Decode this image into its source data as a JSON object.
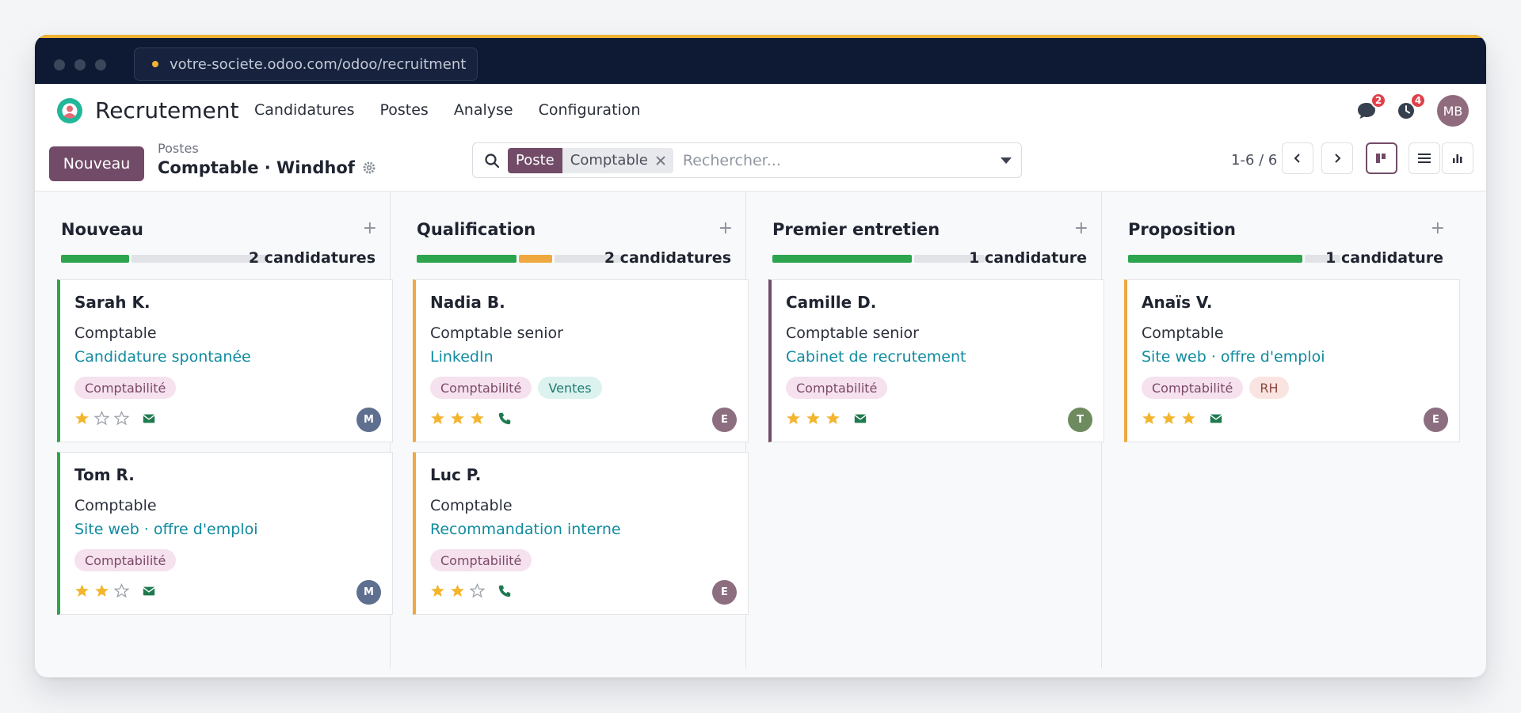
{
  "browser": {
    "url": "votre-societe.odoo.com/odoo/recruitment"
  },
  "app": {
    "name": "Recrutement",
    "menu": [
      "Candidatures",
      "Postes",
      "Analyse",
      "Configuration"
    ],
    "messages_badge": "2",
    "activities_badge": "4",
    "user_initials": "MB"
  },
  "control": {
    "new_label": "Nouveau",
    "breadcrumb": "Postes",
    "title": "Comptable · Windhof",
    "facet_key": "Poste",
    "facet_value": "Comptable",
    "search_placeholder": "Rechercher...",
    "pager": "1-6 / 6"
  },
  "columns": [
    {
      "title": "Nouveau",
      "count": "2 candidatures",
      "cards": [
        {
          "name": "Sarah K.",
          "job": "Comptable",
          "source": "Candidature spontanée",
          "tags": [
            "Comptabilité"
          ],
          "stars": 1,
          "contact": "mail-icon",
          "avatar": "M"
        },
        {
          "name": "Tom R.",
          "job": "Comptable",
          "source": "Site web · offre d'emploi",
          "tags": [
            "Comptabilité"
          ],
          "stars": 2,
          "contact": "mail-icon",
          "avatar": "M"
        }
      ]
    },
    {
      "title": "Qualification",
      "count": "2 candidatures",
      "cards": [
        {
          "name": "Nadia B.",
          "job": "Comptable senior",
          "source": "LinkedIn",
          "tags": [
            "Comptabilité",
            "Ventes"
          ],
          "stars": 3,
          "contact": "phone-icon",
          "avatar": "E"
        },
        {
          "name": "Luc P.",
          "job": "Comptable",
          "source": "Recommandation interne",
          "tags": [
            "Comptabilité"
          ],
          "stars": 2,
          "contact": "phone-icon",
          "avatar": "E"
        }
      ]
    },
    {
      "title": "Premier entretien",
      "count": "1 candidature",
      "cards": [
        {
          "name": "Camille D.",
          "job": "Comptable senior",
          "source": "Cabinet de recrutement",
          "tags": [
            "Comptabilité"
          ],
          "stars": 3,
          "contact": "mail-icon",
          "avatar": "T"
        }
      ]
    },
    {
      "title": "Proposition",
      "count": "1 candidature",
      "cards": [
        {
          "name": "Anaïs V.",
          "job": "Comptable",
          "source": "Site web · offre d'emploi",
          "tags": [
            "Comptabilité",
            "RH"
          ],
          "stars": 3,
          "contact": "mail-icon",
          "avatar": "E"
        }
      ]
    }
  ],
  "colors": {
    "brand": "#714b67",
    "green": "#2da44e",
    "orange": "#f0a840",
    "link": "#108ba0",
    "star": "#f3b52e"
  }
}
